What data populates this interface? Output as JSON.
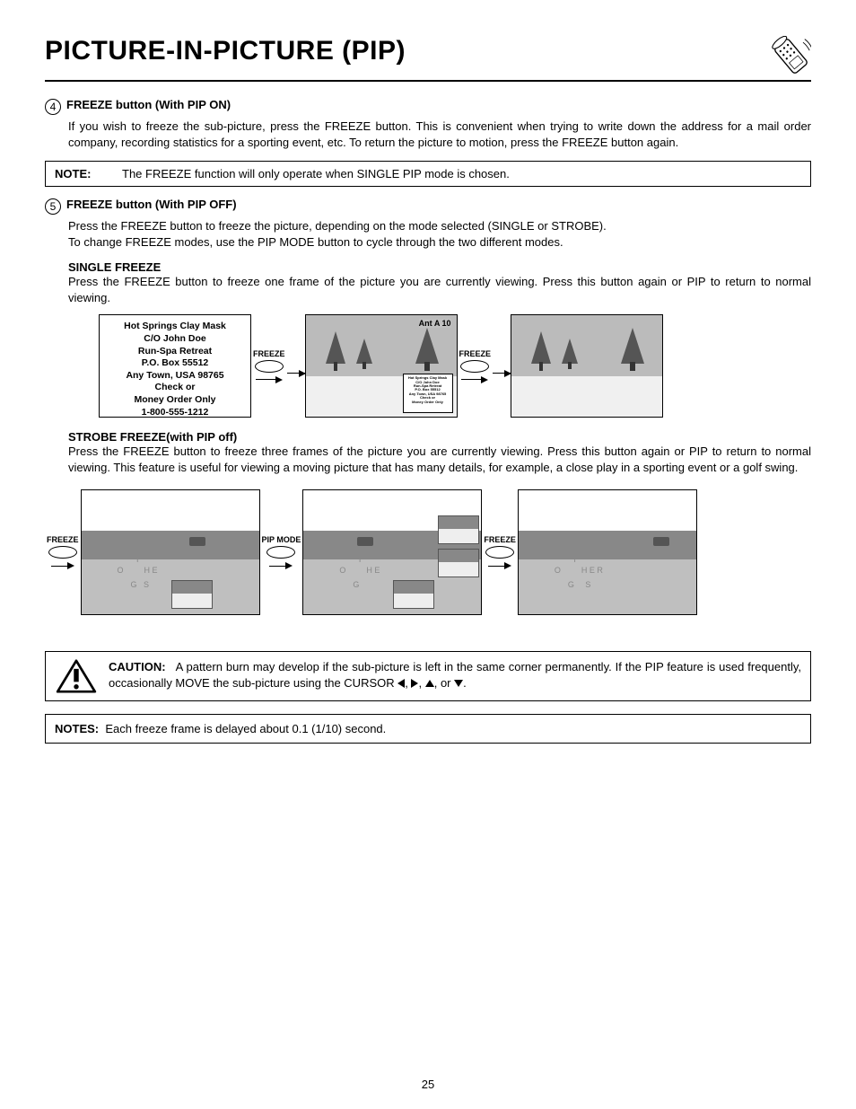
{
  "title": "PICTURE-IN-PICTURE (PIP)",
  "step4": {
    "num": "4",
    "heading": "FREEZE button (With PIP ON)",
    "body": "If you wish to freeze the sub-picture, press the FREEZE button. This is convenient when trying to write down the address for a mail order company, recording statistics for a sporting event, etc.  To return the picture to motion, press the FREEZE button again."
  },
  "noteBox": {
    "label": "NOTE:",
    "text": "The FREEZE function will only operate when SINGLE PIP mode is chosen."
  },
  "step5": {
    "num": "5",
    "heading": "FREEZE button (With PIP OFF)",
    "line1": "Press the FREEZE button to freeze the picture, depending on the mode selected (SINGLE or STROBE).",
    "line2": "To change FREEZE modes, use the PIP MODE button to cycle through the two different modes."
  },
  "singleFreeze": {
    "heading": "SINGLE FREEZE",
    "body": "Press the FREEZE button to freeze one frame of the picture you are currently viewing.  Press this button again or PIP to return to normal viewing."
  },
  "addressBox": {
    "l1": "Hot Springs Clay Mask",
    "l2": "C/O John Doe",
    "l3": "Run-Spa Retreat",
    "l4": "P.O. Box 55512",
    "l5": "Any Town, USA 98765",
    "l6": "Check or",
    "l7": "Money Order Only",
    "l8": "1-800-555-1212"
  },
  "freezeLabel": "FREEZE",
  "pipModeLabel": "PIP MODE",
  "antLabel": "Ant A 10",
  "strobeFreeze": {
    "heading": "STROBE FREEZE(with PIP off)",
    "body": "Press the FREEZE button to freeze three frames of the picture you are currently viewing. Press this button again or PIP to return to normal viewing. This feature is useful for viewing a moving picture that has many details, for example, a close play in a sporting event or a golf swing."
  },
  "caution": {
    "label": "CAUTION:",
    "text": "A pattern burn may develop if the sub-picture is left in the same corner permanently.  If the PIP feature is used frequently, occasionally MOVE the sub-picture using the CURSOR ◀, ▶, ▲, or ▼."
  },
  "notes": {
    "label": "NOTES:",
    "text": "Each freeze frame is delayed about 0.1 (1/10) second."
  },
  "pageNum": "25"
}
